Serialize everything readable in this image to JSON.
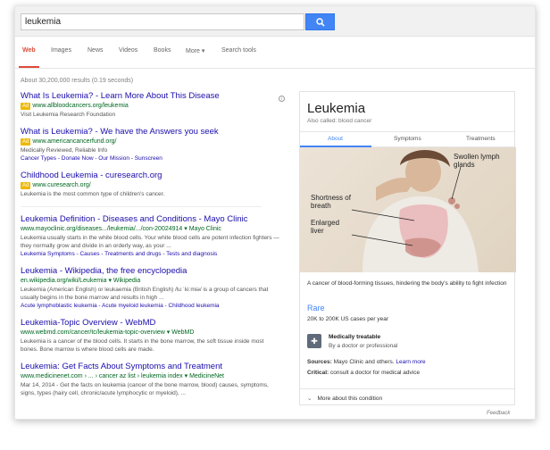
{
  "search": {
    "query": "leukemia"
  },
  "tabs": [
    "Web",
    "Images",
    "News",
    "Videos",
    "Books",
    "More",
    "Search tools"
  ],
  "stats": "About 30,200,000 results (0.19 seconds)",
  "results": [
    {
      "title": "What Is Leukemia? - Learn More About This Disease",
      "ad": "Ad",
      "url": "www.allbloodcancers.org/leukemia",
      "snippet": "Visit Leukemia Research Foundation",
      "links": ""
    },
    {
      "title": "What is Leukemia? - We have the Answers you seek",
      "ad": "Ad",
      "url": "www.americancancerfund.org/",
      "snippet": "Medically Reviewed, Reliable Info",
      "links": "Cancer Types - Donate Now - Our Mission - Sunscreen"
    },
    {
      "title": "Childhood Leukemia - curesearch.org",
      "ad": "Ad",
      "url": "www.curesearch.org/",
      "snippet": "Leukemia is the most common type of children's cancer.",
      "links": ""
    },
    {
      "title": "Leukemia Definition - Diseases and Conditions - Mayo Clinic",
      "ad": "",
      "url": "www.mayoclinic.org/diseases.../leukemia/.../con-20024914 ▾ Mayo Clinic",
      "snippet": "Leukemia usually starts in the white blood cells. Your white blood cells are potent infection fighters — they normally grow and divide in an orderly way, as your ...",
      "links": "Leukemia Symptoms - Causes - Treatments and drugs - Tests and diagnosis"
    },
    {
      "title": "Leukemia - Wikipedia, the free encyclopedia",
      "ad": "",
      "url": "en.wikipedia.org/wiki/Leukemia ▾ Wikipedia",
      "snippet": "Leukemia (American English) or leukaemia (British English) /luːˈkiːmiə/ is a group of cancers that usually begins in the bone marrow and results in high ...",
      "links": "Acute lymphoblastic leukemia - Acute myeloid leukemia - Childhood leukemia"
    },
    {
      "title": "Leukemia-Topic Overview - WebMD",
      "ad": "",
      "url": "www.webmd.com/cancer/tc/leukemia-topic-overview ▾ WebMD",
      "snippet": "Leukemia is a cancer of the blood cells. It starts in the bone marrow, the soft tissue inside most bones. Bone marrow is where blood cells are made.",
      "links": ""
    },
    {
      "title": "Leukemia: Get Facts About Symptoms and Treatment",
      "ad": "",
      "url": "www.medicinenet.com › ... › cancer az list › leukemia index ▾ MedicineNet",
      "snippet": "Mar 14, 2014 - Get the facts on leukemia (cancer of the bone marrow, blood) causes, symptoms, signs, types (hairy cell, chronic/acute lymphocytic or myeloid), ...",
      "links": ""
    }
  ],
  "knowledge_panel": {
    "title": "Leukemia",
    "subtitle": "Also called: blood cancer",
    "tabs": [
      "About",
      "Symptoms",
      "Treatments"
    ],
    "image_labels": [
      "Swollen lymph glands",
      "Shortness of breath",
      "Enlarged liver"
    ],
    "description": "A cancer of blood-forming tissues, hindering the body's ability to fight infection",
    "rarity": "Rare",
    "cases": "20K to 200K US cases per year",
    "treat_title": "Medically treatable",
    "treat_sub": "By a doctor or professional",
    "sources_label": "Sources:",
    "sources": "Mayo Clinic and others.",
    "learn_more": "Learn more",
    "critical_label": "Critical:",
    "critical": "consult a doctor for medical advice",
    "more": "More about this condition"
  },
  "feedback": "Feedback"
}
